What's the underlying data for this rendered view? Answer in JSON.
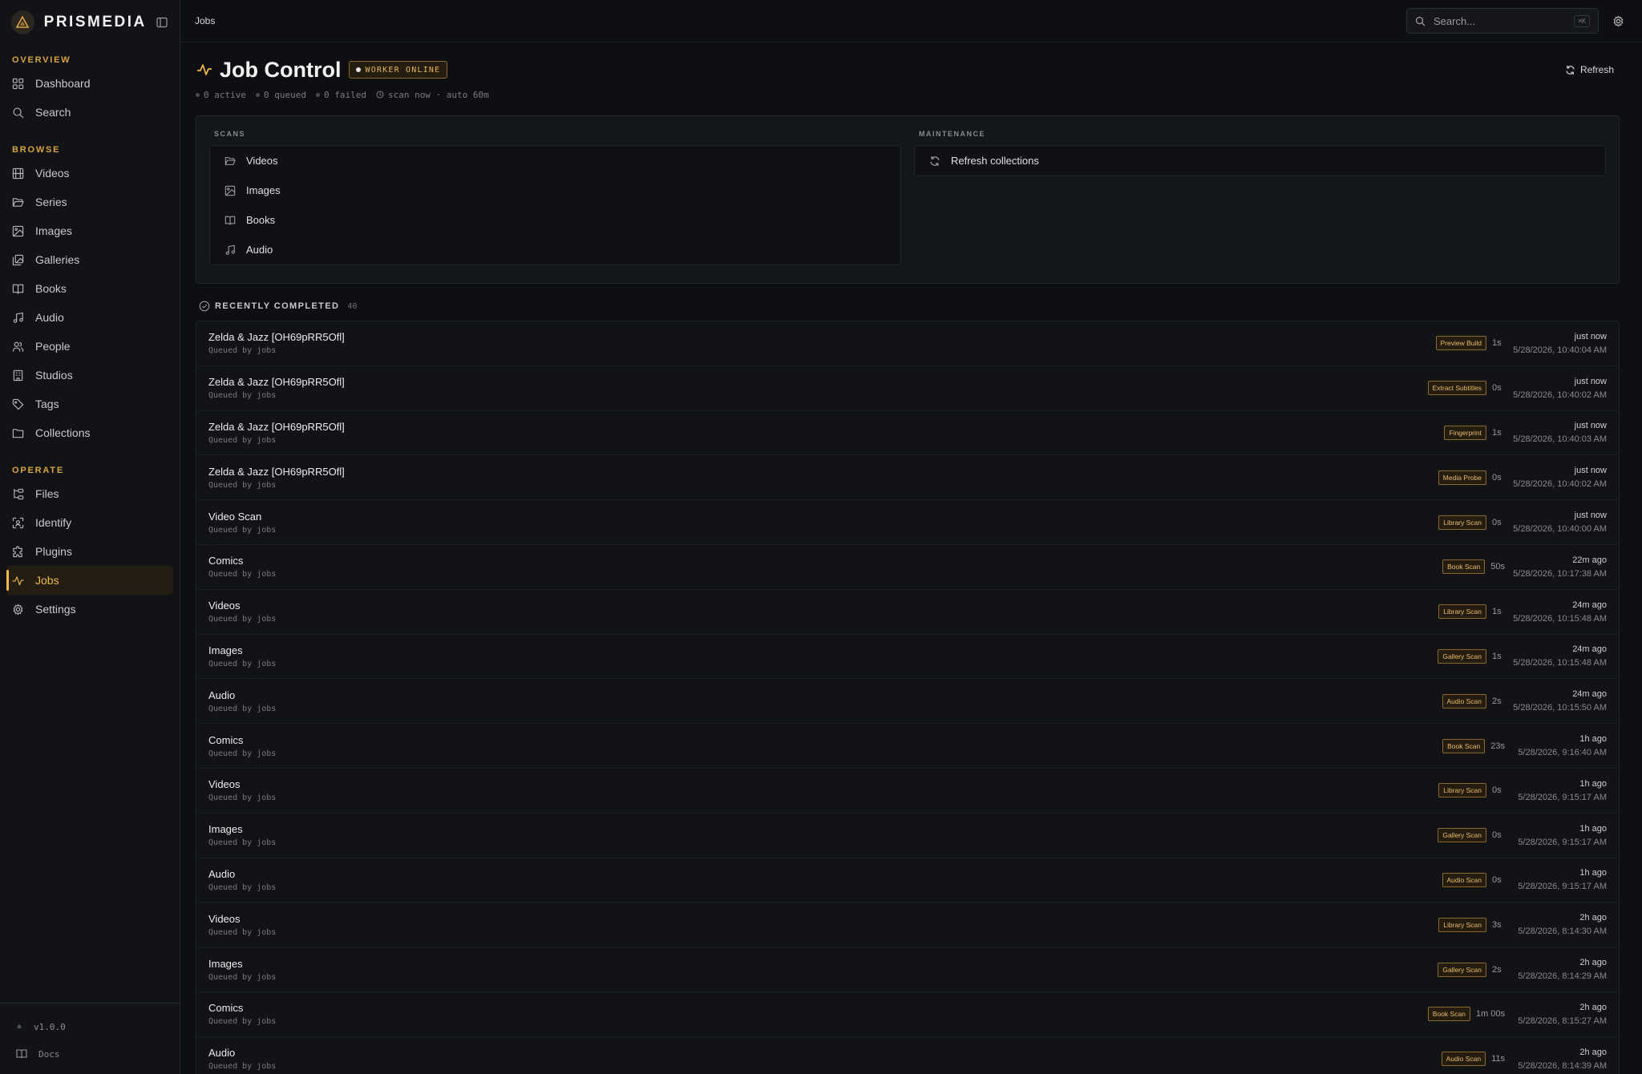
{
  "app": {
    "name": "PRISMEDIA",
    "version": "v1.0.0",
    "docs": "Docs"
  },
  "colors": {
    "accent": "#f0b94a",
    "background": "#0d0f12",
    "sidebar": "#111316"
  },
  "sidebar": {
    "sections": [
      {
        "label": "OVERVIEW",
        "items": [
          {
            "label": "Dashboard",
            "icon": "grid-icon"
          },
          {
            "label": "Search",
            "icon": "search-icon"
          }
        ]
      },
      {
        "label": "BROWSE",
        "items": [
          {
            "label": "Videos",
            "icon": "film-icon"
          },
          {
            "label": "Series",
            "icon": "folder-open-icon"
          },
          {
            "label": "Images",
            "icon": "image-icon"
          },
          {
            "label": "Galleries",
            "icon": "images-icon"
          },
          {
            "label": "Books",
            "icon": "book-icon"
          },
          {
            "label": "Audio",
            "icon": "music-icon"
          },
          {
            "label": "People",
            "icon": "users-icon"
          },
          {
            "label": "Studios",
            "icon": "building-icon"
          },
          {
            "label": "Tags",
            "icon": "tag-icon"
          },
          {
            "label": "Collections",
            "icon": "folder-icon"
          }
        ]
      },
      {
        "label": "OPERATE",
        "items": [
          {
            "label": "Files",
            "icon": "folder-tree-icon"
          },
          {
            "label": "Identify",
            "icon": "scan-face-icon"
          },
          {
            "label": "Plugins",
            "icon": "puzzle-icon"
          },
          {
            "label": "Jobs",
            "icon": "activity-icon",
            "active": true
          },
          {
            "label": "Settings",
            "icon": "gear-icon"
          }
        ]
      }
    ]
  },
  "topbar": {
    "breadcrumb": "Jobs",
    "search_placeholder": "Search...",
    "shortcut": "⌘K"
  },
  "header": {
    "title": "Job Control",
    "status": "WORKER ONLINE",
    "refresh": "Refresh",
    "stats": [
      "0 active",
      "0 queued",
      "0 failed"
    ],
    "schedule": "scan now · auto 60m"
  },
  "scans": {
    "label": "SCANS",
    "items": [
      "Videos",
      "Images",
      "Books",
      "Audio"
    ]
  },
  "maintenance": {
    "label": "MAINTENANCE",
    "items": [
      "Refresh collections"
    ]
  },
  "recent": {
    "label": "RECENTLY COMPLETED",
    "count": "40",
    "rows": [
      {
        "name": "Zelda & Jazz [OH69pRR5Ofl]",
        "sub": "Queued by jobs",
        "tag": "Preview Build",
        "duration": "1s",
        "ago": "just now",
        "time": "5/28/2026, 10:40:04 AM"
      },
      {
        "name": "Zelda & Jazz [OH69pRR5Ofl]",
        "sub": "Queued by jobs",
        "tag": "Extract Subtitles",
        "duration": "0s",
        "ago": "just now",
        "time": "5/28/2026, 10:40:02 AM"
      },
      {
        "name": "Zelda & Jazz [OH69pRR5Ofl]",
        "sub": "Queued by jobs",
        "tag": "Fingerprint",
        "duration": "1s",
        "ago": "just now",
        "time": "5/28/2026, 10:40:03 AM"
      },
      {
        "name": "Zelda & Jazz [OH69pRR5Ofl]",
        "sub": "Queued by jobs",
        "tag": "Media Probe",
        "duration": "0s",
        "ago": "just now",
        "time": "5/28/2026, 10:40:02 AM"
      },
      {
        "name": "Video Scan",
        "sub": "Queued by jobs",
        "tag": "Library Scan",
        "duration": "0s",
        "ago": "just now",
        "time": "5/28/2026, 10:40:00 AM"
      },
      {
        "name": "Comics",
        "sub": "Queued by jobs",
        "tag": "Book Scan",
        "duration": "50s",
        "ago": "22m ago",
        "time": "5/28/2026, 10:17:38 AM"
      },
      {
        "name": "Videos",
        "sub": "Queued by jobs",
        "tag": "Library Scan",
        "duration": "1s",
        "ago": "24m ago",
        "time": "5/28/2026, 10:15:48 AM"
      },
      {
        "name": "Images",
        "sub": "Queued by jobs",
        "tag": "Gallery Scan",
        "duration": "1s",
        "ago": "24m ago",
        "time": "5/28/2026, 10:15:48 AM"
      },
      {
        "name": "Audio",
        "sub": "Queued by jobs",
        "tag": "Audio Scan",
        "duration": "2s",
        "ago": "24m ago",
        "time": "5/28/2026, 10:15:50 AM"
      },
      {
        "name": "Comics",
        "sub": "Queued by jobs",
        "tag": "Book Scan",
        "duration": "23s",
        "ago": "1h ago",
        "time": "5/28/2026, 9:16:40 AM"
      },
      {
        "name": "Videos",
        "sub": "Queued by jobs",
        "tag": "Library Scan",
        "duration": "0s",
        "ago": "1h ago",
        "time": "5/28/2026, 9:15:17 AM"
      },
      {
        "name": "Images",
        "sub": "Queued by jobs",
        "tag": "Gallery Scan",
        "duration": "0s",
        "ago": "1h ago",
        "time": "5/28/2026, 9:15:17 AM"
      },
      {
        "name": "Audio",
        "sub": "Queued by jobs",
        "tag": "Audio Scan",
        "duration": "0s",
        "ago": "1h ago",
        "time": "5/28/2026, 9:15:17 AM"
      },
      {
        "name": "Videos",
        "sub": "Queued by jobs",
        "tag": "Library Scan",
        "duration": "3s",
        "ago": "2h ago",
        "time": "5/28/2026, 8:14:30 AM"
      },
      {
        "name": "Images",
        "sub": "Queued by jobs",
        "tag": "Gallery Scan",
        "duration": "2s",
        "ago": "2h ago",
        "time": "5/28/2026, 8:14:29 AM"
      },
      {
        "name": "Comics",
        "sub": "Queued by jobs",
        "tag": "Book Scan",
        "duration": "1m 00s",
        "ago": "2h ago",
        "time": "5/28/2026, 8:15:27 AM"
      },
      {
        "name": "Audio",
        "sub": "Queued by jobs",
        "tag": "Audio Scan",
        "duration": "11s",
        "ago": "2h ago",
        "time": "5/28/2026, 8:14:39 AM"
      }
    ]
  }
}
